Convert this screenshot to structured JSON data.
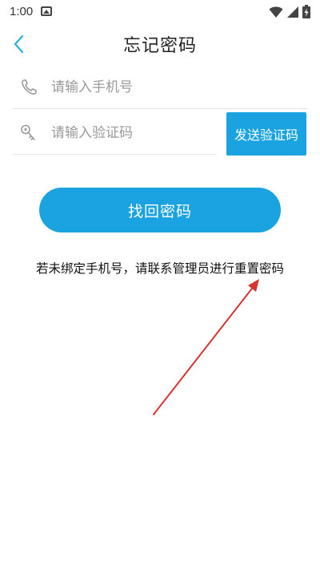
{
  "status_bar": {
    "time": "1:00",
    "icons": [
      "photo-icon",
      "wifi-icon",
      "signal-icon",
      "battery-charging-icon"
    ]
  },
  "header": {
    "title": "忘记密码",
    "back_icon": "chevron-left-icon"
  },
  "form": {
    "phone": {
      "placeholder": "请输入手机号",
      "value": "",
      "icon": "phone-icon"
    },
    "code": {
      "placeholder": "请输入验证码",
      "value": "",
      "icon": "key-icon"
    },
    "send_code_label": "发送验证码",
    "submit_label": "找回密码"
  },
  "hint": {
    "text": "若未绑定手机号，请联系管理员进行重置密码"
  },
  "colors": {
    "accent": "#1aa3e0",
    "back_icon": "#2ab0d8",
    "annotation_arrow": "#d63333"
  }
}
